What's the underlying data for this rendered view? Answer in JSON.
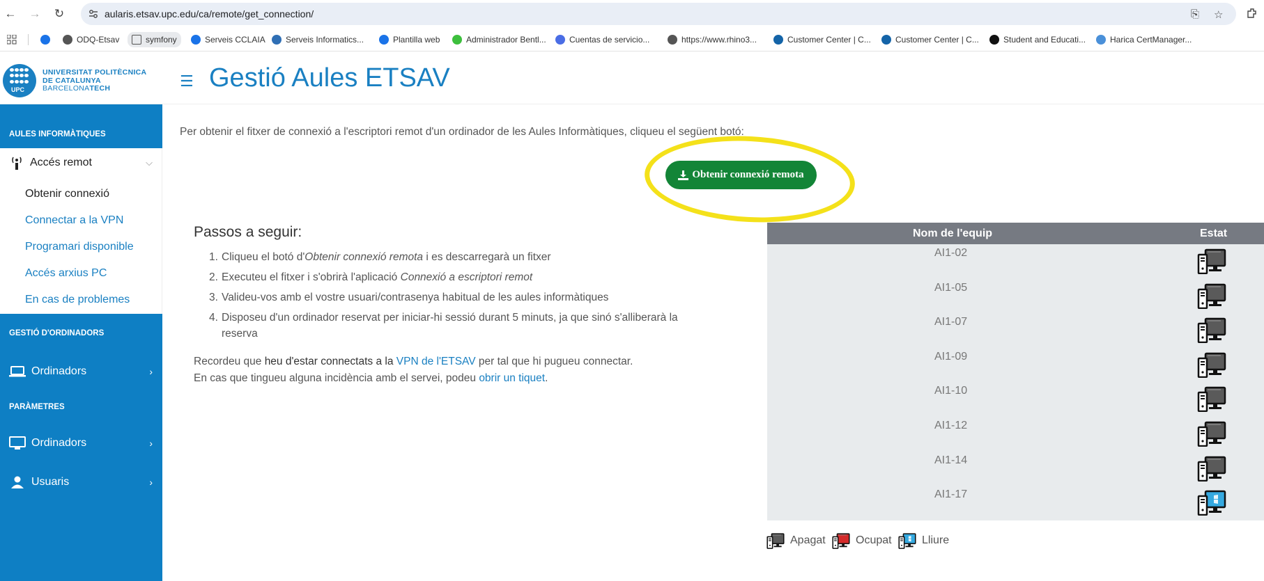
{
  "browser": {
    "url": "aularis.etsav.upc.edu/ca/remote/get_connection/",
    "bookmarks": [
      {
        "label": "ODQ-Etsav",
        "color": "#555555"
      },
      {
        "label": "symfony",
        "color": "#666666"
      },
      {
        "label": "Serveis CCLAIA",
        "color": "#1a73e8"
      },
      {
        "label": "Serveis Informatics...",
        "color": "#2f6fb5"
      },
      {
        "label": "Plantilla web",
        "color": "#1a73e8"
      },
      {
        "label": "Administrador Bentl...",
        "color": "#3dbf3d"
      },
      {
        "label": "Cuentas de servicio...",
        "color": "#4a6de5"
      },
      {
        "label": "https://www.rhino3...",
        "color": "#555555"
      },
      {
        "label": "Customer Center | C...",
        "color": "#1464a8"
      },
      {
        "label": "Customer Center | C...",
        "color": "#1464a8"
      },
      {
        "label": "Student and Educati...",
        "color": "#111111"
      },
      {
        "label": "Harica CertManager...",
        "color": "#4a90d9"
      }
    ]
  },
  "header": {
    "logo": {
      "line1": "UNIVERSITAT POLITÈCNICA",
      "line2": "DE CATALUNYA",
      "line3a": "BARCELONA",
      "line3b": "TECH",
      "badge": "UPC"
    },
    "title": "Gestió Aules ETSAV"
  },
  "sidebar": {
    "section_aules": "AULES INFORMÀTIQUES",
    "remote_label": "Accés remot",
    "sub_items": [
      "Obtenir connexió",
      "Connectar a la VPN",
      "Programari disponible",
      "Accés arxius PC",
      "En cas de problemes"
    ],
    "section_gestio": "GESTIÓ D'ORDINADORS",
    "gestio_item": "Ordinadors",
    "section_params": "PARÀMETRES",
    "params_items": [
      "Ordinadors",
      "Usuaris"
    ]
  },
  "main": {
    "intro": "Per obtenir el fitxer de connexió a l'escriptori remot d'un ordinador de les Aules Informàtiques, cliqueu el següent botó:",
    "download_button": "Obtenir connexió remota",
    "steps_title": "Passos a seguir:",
    "steps": [
      {
        "n": "1.",
        "pre": "Cliqueu el botó d'",
        "em": "Obtenir connexió remota",
        "post": " i es descarregarà un fitxer"
      },
      {
        "n": "2.",
        "pre": "Executeu el fitxer i s'obrirà l'aplicació ",
        "em": "Connexió a escriptori remot",
        "post": ""
      },
      {
        "n": "3.",
        "pre": "Valideu-vos amb el vostre usuari/contrasenya habitual de les aules informàtiques",
        "em": "",
        "post": ""
      },
      {
        "n": "4.",
        "pre": "Disposeu d'un ordinador reservat per iniciar-hi sessió durant 5 minuts, ja que sinó s'alliberarà la reserva",
        "em": "",
        "post": ""
      }
    ],
    "note1": {
      "pre": "Recordeu que ",
      "bold": "heu d'estar connectats a la",
      "link": "VPN de l'ETSAV",
      "post": " per tal que hi pugueu connectar."
    },
    "note2": {
      "pre": "En cas que tingueu alguna incidència amb el servei, podeu ",
      "link": "obrir un tiquet",
      "post": "."
    }
  },
  "table": {
    "col_name": "Nom de l'equip",
    "col_status": "Estat",
    "rows": [
      {
        "name": "AI1-02",
        "status": "off"
      },
      {
        "name": "AI1-05",
        "status": "off"
      },
      {
        "name": "AI1-07",
        "status": "off"
      },
      {
        "name": "AI1-09",
        "status": "off"
      },
      {
        "name": "AI1-10",
        "status": "off"
      },
      {
        "name": "AI1-12",
        "status": "off"
      },
      {
        "name": "AI1-14",
        "status": "off"
      },
      {
        "name": "AI1-17",
        "status": "free"
      }
    ]
  },
  "legend": [
    {
      "label": "Apagat",
      "status": "off"
    },
    {
      "label": "Ocupat",
      "status": "busy"
    },
    {
      "label": "Lliure",
      "status": "free"
    }
  ],
  "colors": {
    "brand": "#1a80c2",
    "sidebar": "#0e7fc4",
    "button": "#138537",
    "highlight": "#f4e11a",
    "off": "#5a5a5a",
    "busy": "#d42a2a",
    "free": "#35a9e0"
  }
}
